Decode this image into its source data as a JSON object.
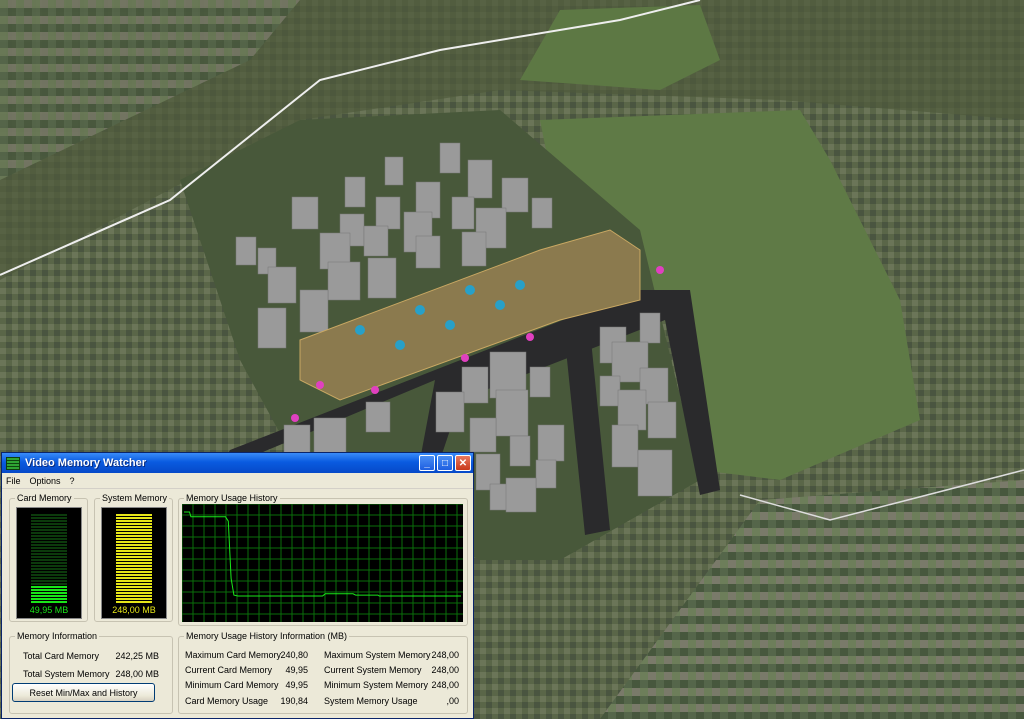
{
  "window": {
    "title": "Video Memory Watcher",
    "minimize_glyph": "_",
    "maximize_glyph": "□",
    "close_glyph": "✕"
  },
  "menu": {
    "items": [
      "File",
      "Options",
      "?"
    ]
  },
  "card_memory": {
    "label": "Card Memory",
    "value": "49,95 MB",
    "fill_fraction": 0.21,
    "color": "#19e619"
  },
  "system_memory": {
    "label": "System Memory",
    "value": "248,00 MB",
    "fill_fraction": 1.0,
    "color": "#e6e619"
  },
  "history": {
    "label": "Memory Usage History",
    "line_color": "#19e619",
    "grid_color": "#0a6e0a",
    "points": [
      [
        0,
        240.8
      ],
      [
        2,
        240.8
      ],
      [
        2.5,
        230
      ],
      [
        15,
        230
      ],
      [
        16,
        220
      ],
      [
        17,
        90
      ],
      [
        18,
        52
      ],
      [
        19.5,
        49.95
      ],
      [
        50,
        49.95
      ],
      [
        51,
        55
      ],
      [
        61,
        55
      ],
      [
        62,
        52
      ],
      [
        70,
        52
      ],
      [
        70.5,
        49.95
      ],
      [
        100,
        49.95
      ]
    ],
    "y_max": 250
  },
  "memory_info": {
    "label": "Memory Information",
    "total_card_label": "Total Card Memory",
    "total_card_value": "242,25 MB",
    "total_system_label": "Total System Memory",
    "total_system_value": "248,00 MB"
  },
  "reset_button": "Reset Min/Max and History",
  "history_info": {
    "label": "Memory Usage History Information (MB)",
    "rows": [
      {
        "l1": "Maximum Card Memory",
        "v1": "240,80",
        "l2": "Maximum System Memory",
        "v2": "248,00"
      },
      {
        "l1": "Current Card Memory",
        "v1": "49,95",
        "l2": "Current System Memory",
        "v2": "248,00"
      },
      {
        "l1": "Minimum Card Memory",
        "v1": "49,95",
        "l2": "Minimum System Memory",
        "v2": "248,00"
      },
      {
        "l1": "Card Memory Usage",
        "v1": "190,84",
        "l2": "System Memory Usage",
        "v2": ",00"
      }
    ]
  }
}
